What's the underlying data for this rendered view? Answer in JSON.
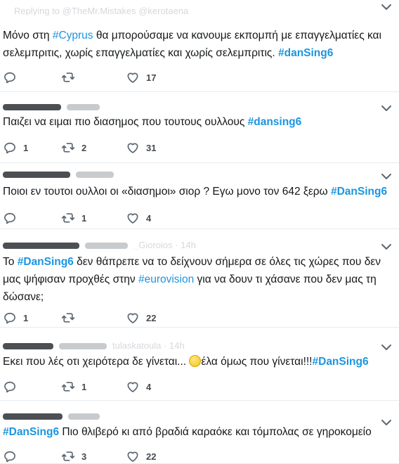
{
  "tweets": [
    {
      "header": "Replying to @TheMr.Mistakes @kerotaena",
      "segments": [
        {
          "t": "Μόνο στη ",
          "c": "text"
        },
        {
          "t": "#Cyprus",
          "c": "hashtag"
        },
        {
          "t": " θα μπορούσαμε να κανουμε εκπομπή με επαγγελματίες και σελεμπριτις, χωρίς επαγγελματίες και χωρίς σελεμπριτις. ",
          "c": "text"
        },
        {
          "t": "#danSing6",
          "c": "hashtag bold"
        }
      ],
      "replies": "",
      "retweets": "",
      "likes": "17"
    },
    {
      "header": "",
      "segments": [
        {
          "t": "Παιζει να ειμαι πιο διασημος που τουτους ουλλους ",
          "c": "text"
        },
        {
          "t": "#dansing6",
          "c": "hashtag bold"
        }
      ],
      "replies": "1",
      "retweets": "2",
      "likes": "31"
    },
    {
      "header": "",
      "segments": [
        {
          "t": "Ποιοι εν τουτοι ουλλοι οι «διασημοι» σιορ ? Εγω μονο τον 642 ξερω ",
          "c": "text"
        },
        {
          "t": "#DanSing6",
          "c": "hashtag bold"
        }
      ],
      "replies": "",
      "retweets": "1",
      "likes": "4"
    },
    {
      "header": "_Gioroios · 14h",
      "segments": [
        {
          "t": "Το ",
          "c": "text"
        },
        {
          "t": "#DanSing6",
          "c": "hashtag bold"
        },
        {
          "t": " δεν θάπρεπε να το δείχνουν σήμερα σε όλες τις χώρες που δεν μας ψήφισαν προχθές στην ",
          "c": "text"
        },
        {
          "t": "#eurovision",
          "c": "hashtag"
        },
        {
          "t": " για να δουν τι χάσανε που δεν μας τη δώσανε;",
          "c": "text"
        }
      ],
      "replies": "1",
      "retweets": "",
      "likes": "22"
    },
    {
      "header": "tulaskatoula · 14h",
      "segments": [
        {
          "t": "Εκει που λές οτι χειρότερα δε γίνεται... ",
          "c": "text"
        },
        {
          "t": "",
          "c": "emoji"
        },
        {
          "t": "έλα όμως που γίνεται!!!",
          "c": "text"
        },
        {
          "t": "#DanSing6",
          "c": "hashtag bold"
        }
      ],
      "replies": "",
      "retweets": "1",
      "likes": "4"
    },
    {
      "header": "",
      "segments": [
        {
          "t": "#DanSing6",
          "c": "hashtag bold"
        },
        {
          "t": " Πιο θλιβερό κι από βραδιά καραόκε και τόμπολας σε γηροκομείο",
          "c": "text"
        }
      ],
      "replies": "",
      "retweets": "3",
      "likes": "22"
    }
  ],
  "colors": {
    "hashtag": "#1b95e0",
    "text": "#14171a",
    "icon": "#5b6670",
    "divider": "#e6ecf0"
  },
  "icons": {
    "reply": "reply-icon",
    "retweet": "retweet-icon",
    "like": "like-icon",
    "more": "chevron-down-icon"
  }
}
